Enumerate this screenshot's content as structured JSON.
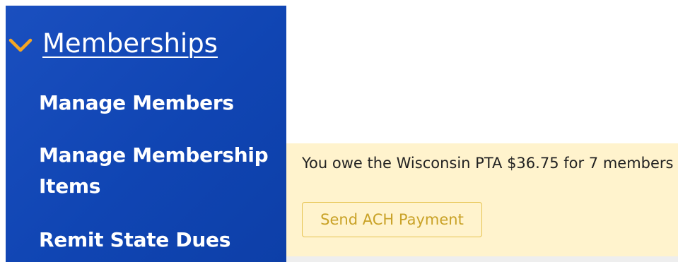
{
  "sidebar": {
    "section_title": "Memberships",
    "items": [
      {
        "label": "Manage Members"
      },
      {
        "label": "Manage Membership Items"
      },
      {
        "label": "Remit State Dues"
      }
    ]
  },
  "notice": {
    "message": "You owe the Wisconsin PTA $36.75 for 7 members",
    "button_label": "Send ACH Payment"
  },
  "colors": {
    "sidebar_bg": "#1348b8",
    "chevron": "#f5a623",
    "notice_bg": "#fff3cd",
    "button_text": "#c9a227"
  },
  "icons": {
    "chevron": "chevron-down-icon"
  }
}
